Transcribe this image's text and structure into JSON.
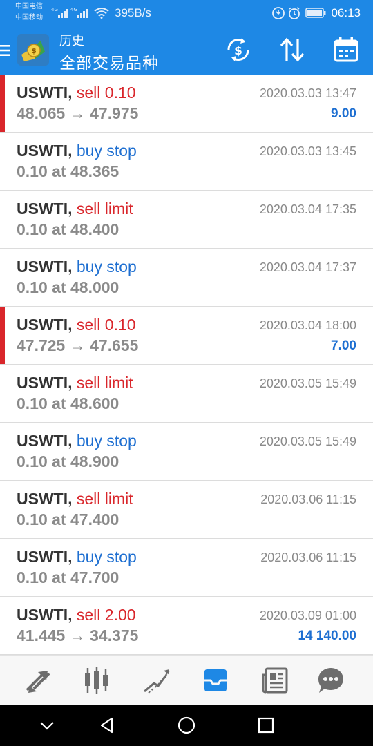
{
  "status_bar": {
    "carrier1": "中国电信",
    "carrier2": "中国移动",
    "speed": "395B/s",
    "time": "06:13"
  },
  "header": {
    "title": "历史",
    "subtitle": "全部交易品种",
    "icons": [
      "menu-icon",
      "metatrader-logo",
      "currency-exchange-icon",
      "sort-icon",
      "calendar-icon"
    ]
  },
  "trades": [
    {
      "symbol": "USWTI,",
      "action": "sell 0.10",
      "action_color": "red",
      "detail": "48.065 → 47.975",
      "time": "2020.03.03 13:47",
      "profit": "9.00",
      "marker": true
    },
    {
      "symbol": "USWTI,",
      "action": "buy stop",
      "action_color": "blue",
      "detail": "0.10 at 48.365",
      "time": "2020.03.03 13:45",
      "profit": "",
      "marker": false
    },
    {
      "symbol": "USWTI,",
      "action": "sell limit",
      "action_color": "red",
      "detail": "0.10 at 48.400",
      "time": "2020.03.04 17:35",
      "profit": "",
      "marker": false
    },
    {
      "symbol": "USWTI,",
      "action": "buy stop",
      "action_color": "blue",
      "detail": "0.10 at 48.000",
      "time": "2020.03.04 17:37",
      "profit": "",
      "marker": false
    },
    {
      "symbol": "USWTI,",
      "action": "sell 0.10",
      "action_color": "red",
      "detail": "47.725 → 47.655",
      "time": "2020.03.04 18:00",
      "profit": "7.00",
      "marker": true
    },
    {
      "symbol": "USWTI,",
      "action": "sell limit",
      "action_color": "red",
      "detail": "0.10 at 48.600",
      "time": "2020.03.05 15:49",
      "profit": "",
      "marker": false
    },
    {
      "symbol": "USWTI,",
      "action": "buy stop",
      "action_color": "blue",
      "detail": "0.10 at 48.900",
      "time": "2020.03.05 15:49",
      "profit": "",
      "marker": false
    },
    {
      "symbol": "USWTI,",
      "action": "sell limit",
      "action_color": "red",
      "detail": "0.10 at 47.400",
      "time": "2020.03.06 11:15",
      "profit": "",
      "marker": false
    },
    {
      "symbol": "USWTI,",
      "action": "buy stop",
      "action_color": "blue",
      "detail": "0.10 at 47.700",
      "time": "2020.03.06 11:15",
      "profit": "",
      "marker": false
    },
    {
      "symbol": "USWTI,",
      "action": "sell 2.00",
      "action_color": "red",
      "detail": "41.445 → 34.375",
      "time": "2020.03.09 01:00",
      "profit": "14 140.00",
      "marker": false
    }
  ],
  "bottom_nav": {
    "items": [
      "quotes-icon",
      "chart-icon",
      "trade-icon",
      "history-icon",
      "news-icon",
      "chat-icon"
    ],
    "active": "history-icon",
    "active_color": "#1e88e5"
  },
  "colors": {
    "accent": "#1e88e5",
    "sell": "#d9262b",
    "buy": "#1e6fd1",
    "muted": "#8a8a8a"
  }
}
